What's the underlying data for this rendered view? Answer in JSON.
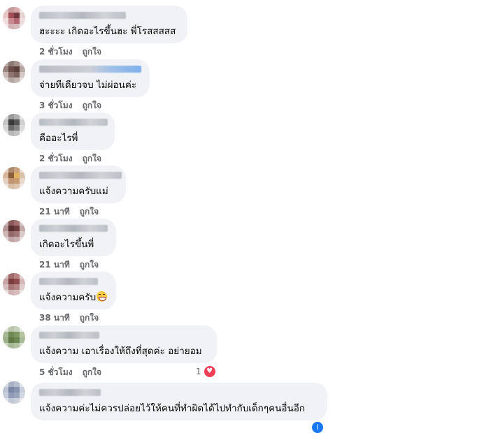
{
  "comments": [
    {
      "text": "ฮะะะะ เกิดอะไรขึ้นฮะ พี่โรสสสสส",
      "time": "2 ชั่วโมง",
      "like_label": "ถูกใจ"
    },
    {
      "text": "จ่ายทีเดียวจบ ไม่ผ่อนค่ะ",
      "time": "3 ชั่วโมง",
      "like_label": "ถูกใจ"
    },
    {
      "text": "คืออะไรพี่",
      "time": "2 ชั่วโมง",
      "like_label": "ถูกใจ"
    },
    {
      "text": "แจ้งความครับแม่",
      "time": "21 นาที",
      "like_label": "ถูกใจ"
    },
    {
      "text": "เกิดอะไรขึ้นพี่",
      "time": "21 นาที",
      "like_label": "ถูกใจ"
    },
    {
      "text": "แจ้งความครับ",
      "time": "38 นาที",
      "like_label": "ถูกใจ",
      "emoji": "grinning-face"
    },
    {
      "text": "แจ้งความ เอาเรื่องให้ถึงที่สุดค่ะ อย่ายอม",
      "time": "5 ชั่วโมง",
      "like_label": "ถูกใจ",
      "reaction_count": "1",
      "reaction_icon": "heart-icon"
    },
    {
      "text": "แจ้งความค่ะไม่ควรปล่อยไว้ให้คนที่ทำผิดได้ไปทำกับเด็กๆคนอื่นอีก",
      "time": "",
      "like_label": ""
    }
  ],
  "colors": {
    "bubble": "#f0f2f5",
    "meta": "#65676b",
    "text": "#050505",
    "heart": "#f33e58",
    "info": "#1877f2"
  }
}
